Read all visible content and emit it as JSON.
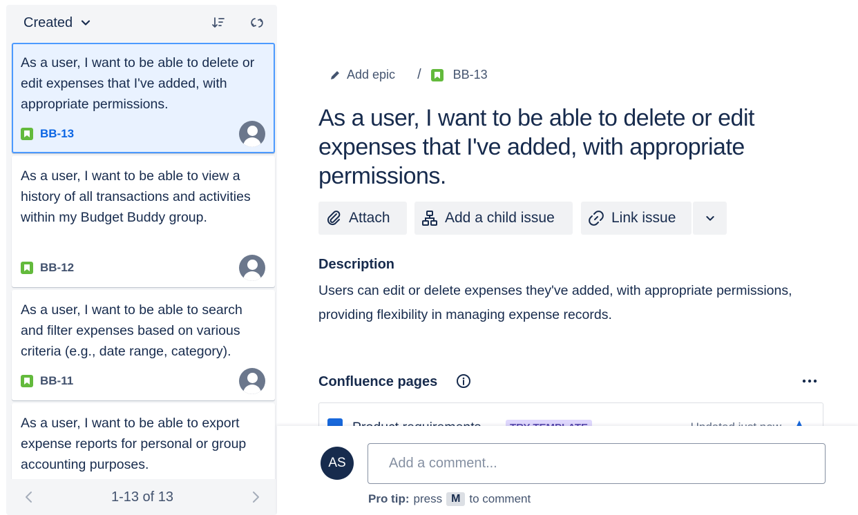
{
  "list": {
    "sort_label": "Created",
    "cards": [
      {
        "title": "As a user, I want to be able to delete or edit expenses that I've added, with appropriate permissions.",
        "key": "BB-13"
      },
      {
        "title": "As a user, I want to be able to view a history of all transactions and activities within my Budget Buddy group.",
        "key": "BB-12"
      },
      {
        "title": "As a user, I want to be able to search and filter expenses based on various criteria (e.g., date range, category).",
        "key": "BB-11"
      },
      {
        "title": "As a user, I want to be able to export expense reports for personal or group accounting purposes.",
        "key": ""
      }
    ],
    "pagination": "1-13 of 13"
  },
  "breadcrumb": {
    "add_epic": "Add epic",
    "separator": "/",
    "issue_key": "BB-13"
  },
  "issue": {
    "title": "As a user, I want to be able to delete or edit expenses that I've added, with appropriate permissions.",
    "actions": {
      "attach": "Attach",
      "add_child": "Add a child issue",
      "link_issue": "Link issue"
    },
    "description_label": "Description",
    "description": "Users can edit or delete expenses they've added, with appropriate permissions, providing flexibility in managing expense records.",
    "confluence_label": "Confluence pages",
    "confluence_item": {
      "title": "Product requirements",
      "badge": "TRY TEMPLATE",
      "updated": "Updated just now"
    }
  },
  "comment": {
    "avatar_initials": "AS",
    "placeholder": "Add a comment...",
    "pro_tip_label": "Pro tip:",
    "pro_tip_press": "press",
    "pro_tip_key": "M",
    "pro_tip_rest": "to comment"
  },
  "colors": {
    "story_green": "#63ba3c",
    "selected_border": "#4c9aff",
    "selected_bg": "#e9f2ff",
    "avatar_dark": "#172b4d"
  }
}
